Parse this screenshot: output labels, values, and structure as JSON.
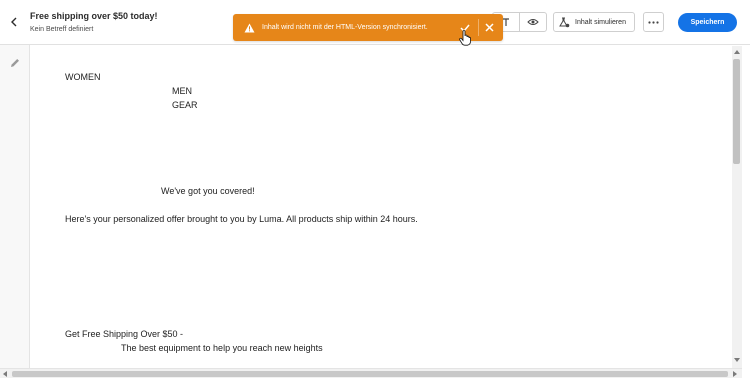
{
  "header": {
    "title": "Free shipping over $50 today!",
    "subtitle": "Kein Betreff definiert",
    "back_icon": "chevron-left-icon"
  },
  "toolbar": {
    "text_tool_icon": "text-icon",
    "preview_icon": "eye-icon",
    "simulate_label": "Inhalt simulieren",
    "simulate_icon": "simulate-flask-icon",
    "more_icon": "more-horizontal-icon",
    "save_label": "Speichern",
    "save_color": "#1473e6"
  },
  "toast": {
    "message": "Inhalt wird nicht mit der HTML-Version synchronisiert.",
    "color": "#e68619",
    "warning_icon": "alert-triangle-icon",
    "confirm_icon": "checkmark-icon",
    "close_icon": "close-icon"
  },
  "sidebar": {
    "edit_icon": "pencil-icon"
  },
  "email": {
    "nav": [
      "WOMEN",
      "MEN",
      "GEAR"
    ],
    "headline": "We've got you covered!",
    "offer": "Here's your personalized offer brought to you by Luma. All products ship within 24 hours.",
    "promo_title": "Get Free Shipping Over $50 -",
    "promo_sub": "The best equipment to help you reach new heights"
  }
}
